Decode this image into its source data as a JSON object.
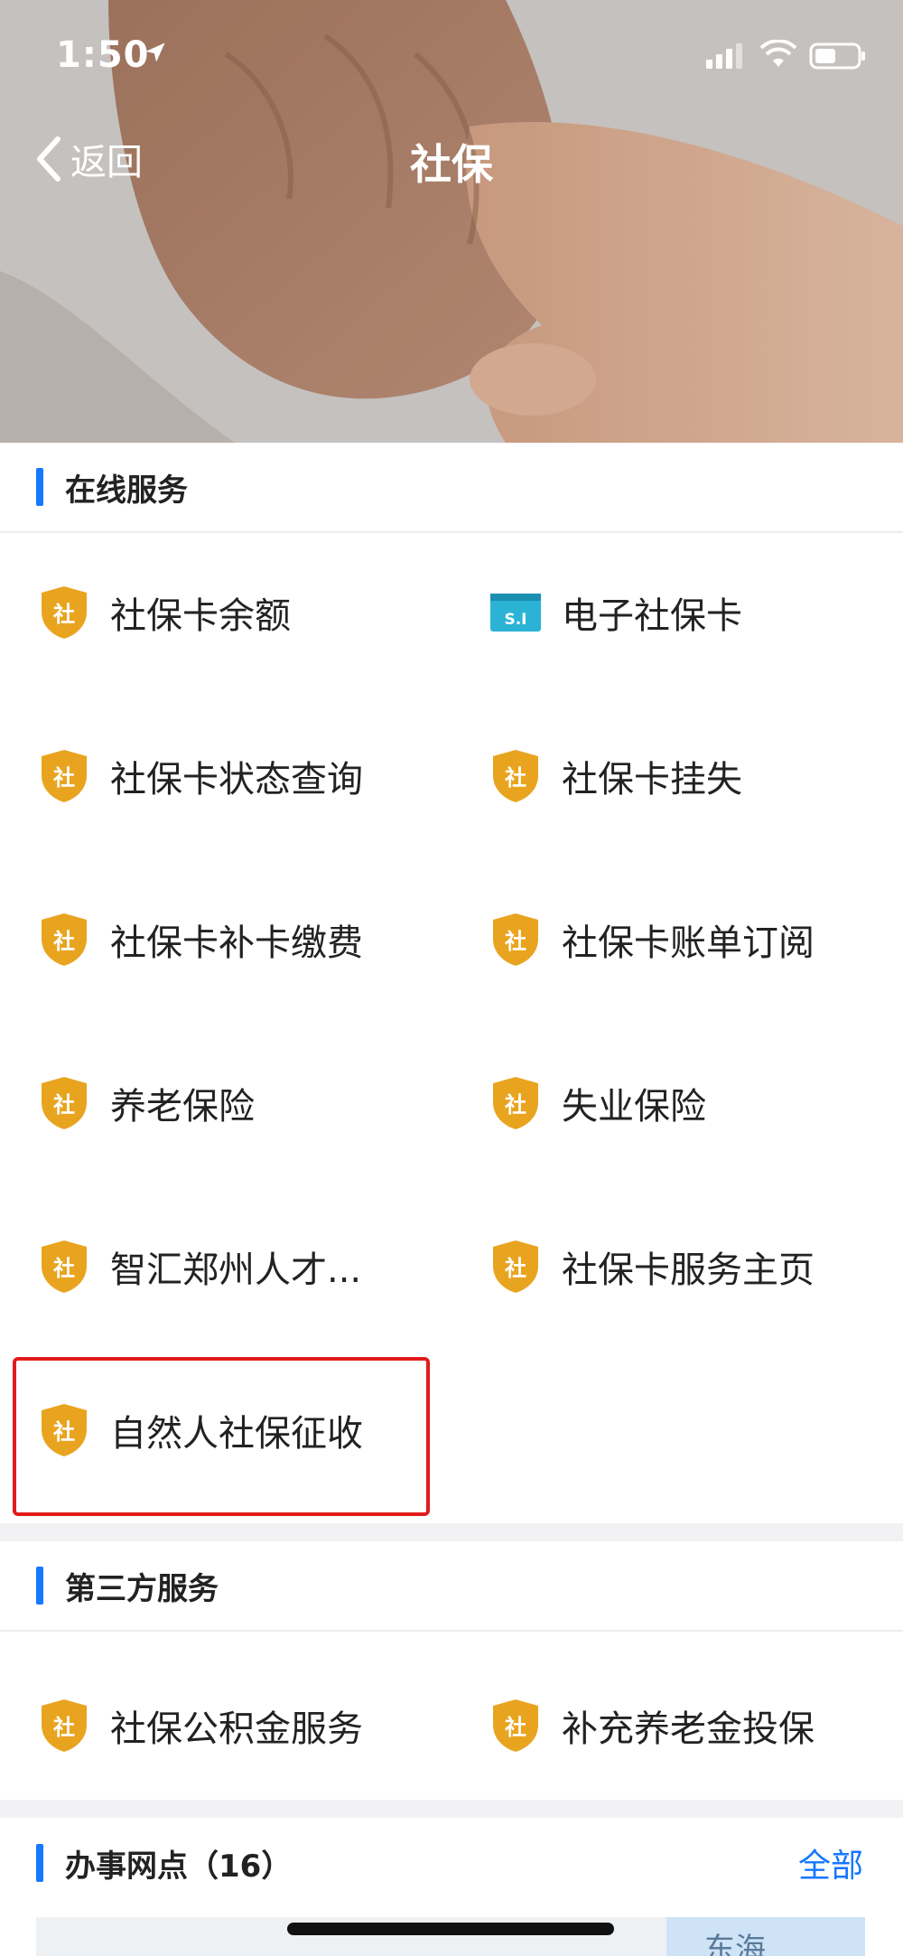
{
  "status": {
    "time": "1:50"
  },
  "nav": {
    "back_label": "返回",
    "title": "社保"
  },
  "online": {
    "title": "在线服务",
    "items": [
      {
        "label": "社保卡余额",
        "icon": "shield-she-icon"
      },
      {
        "label": "电子社保卡",
        "icon": "si-card-icon"
      },
      {
        "label": "社保卡状态查询",
        "icon": "shield-she-icon"
      },
      {
        "label": "社保卡挂失",
        "icon": "shield-she-icon"
      },
      {
        "label": "社保卡补卡缴费",
        "icon": "shield-she-icon"
      },
      {
        "label": "社保卡账单订阅",
        "icon": "shield-she-icon"
      },
      {
        "label": "养老保险",
        "icon": "shield-she-icon"
      },
      {
        "label": "失业保险",
        "icon": "shield-she-icon"
      },
      {
        "label": "智汇郑州人才...",
        "icon": "shield-she-icon"
      },
      {
        "label": "社保卡服务主页",
        "icon": "shield-she-icon"
      },
      {
        "label": "自然人社保征收",
        "icon": "shield-she-icon"
      }
    ]
  },
  "third": {
    "title": "第三方服务",
    "items": [
      {
        "label": "社保公积金服务",
        "icon": "shield-she-icon"
      },
      {
        "label": "补充养老金投保",
        "icon": "shield-she-icon"
      }
    ]
  },
  "offices": {
    "title": "办事网点（16）",
    "all_label": "全部"
  },
  "map": {
    "sea_label": "东海"
  },
  "icon_glyphs": {
    "shield": "社",
    "card": "S.I"
  },
  "colors": {
    "accent": "#1677ff",
    "shield": "#e9a41f",
    "card": "#2bb3d6",
    "highlight": "#e31b1b"
  }
}
